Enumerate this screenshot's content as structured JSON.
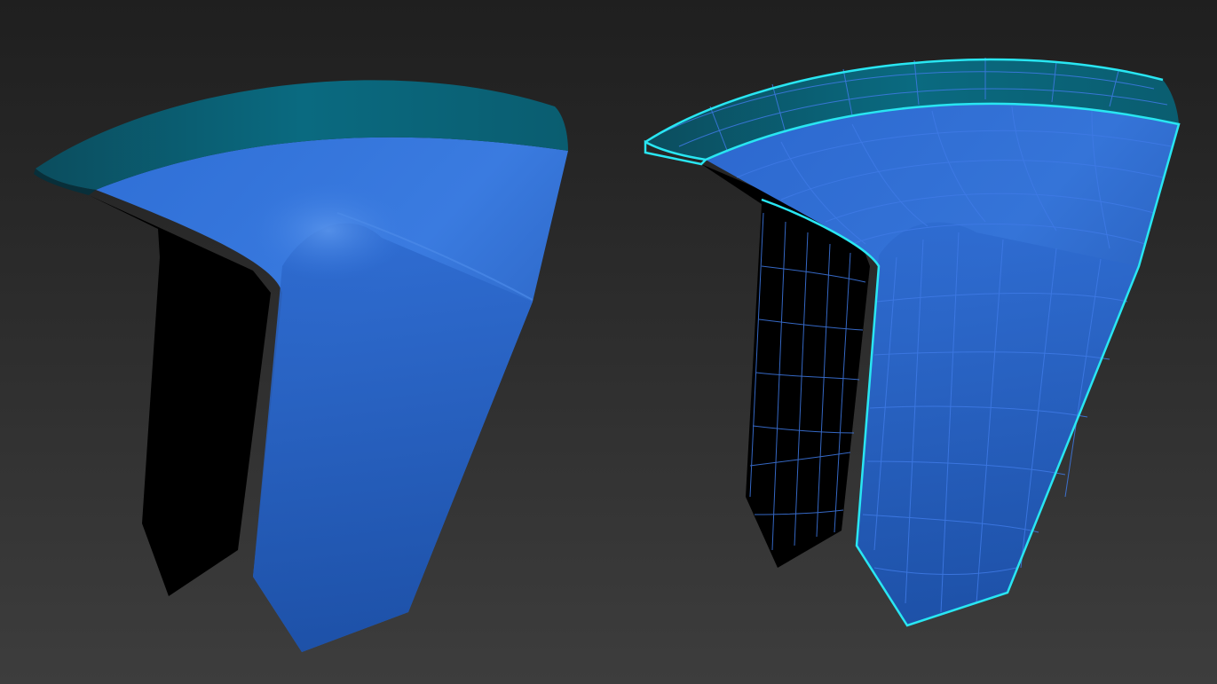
{
  "viewport": {
    "background_top": "#1f1f1f",
    "background_bottom": "#3d3d3d"
  },
  "models": [
    {
      "name": "smooth-shaded",
      "body_color": "#2a63c4",
      "cap_color": "#0a5e72",
      "interior_color": "#000000",
      "wireframe": false,
      "selection_outline": false
    },
    {
      "name": "wireframe-overlay",
      "body_color": "#2a63c4",
      "cap_color": "#0a6478",
      "interior_color": "#000000",
      "wireframe": true,
      "wire_color": "#3f7ae6",
      "selection_outline": true,
      "outline_color": "#29e6f2"
    }
  ]
}
